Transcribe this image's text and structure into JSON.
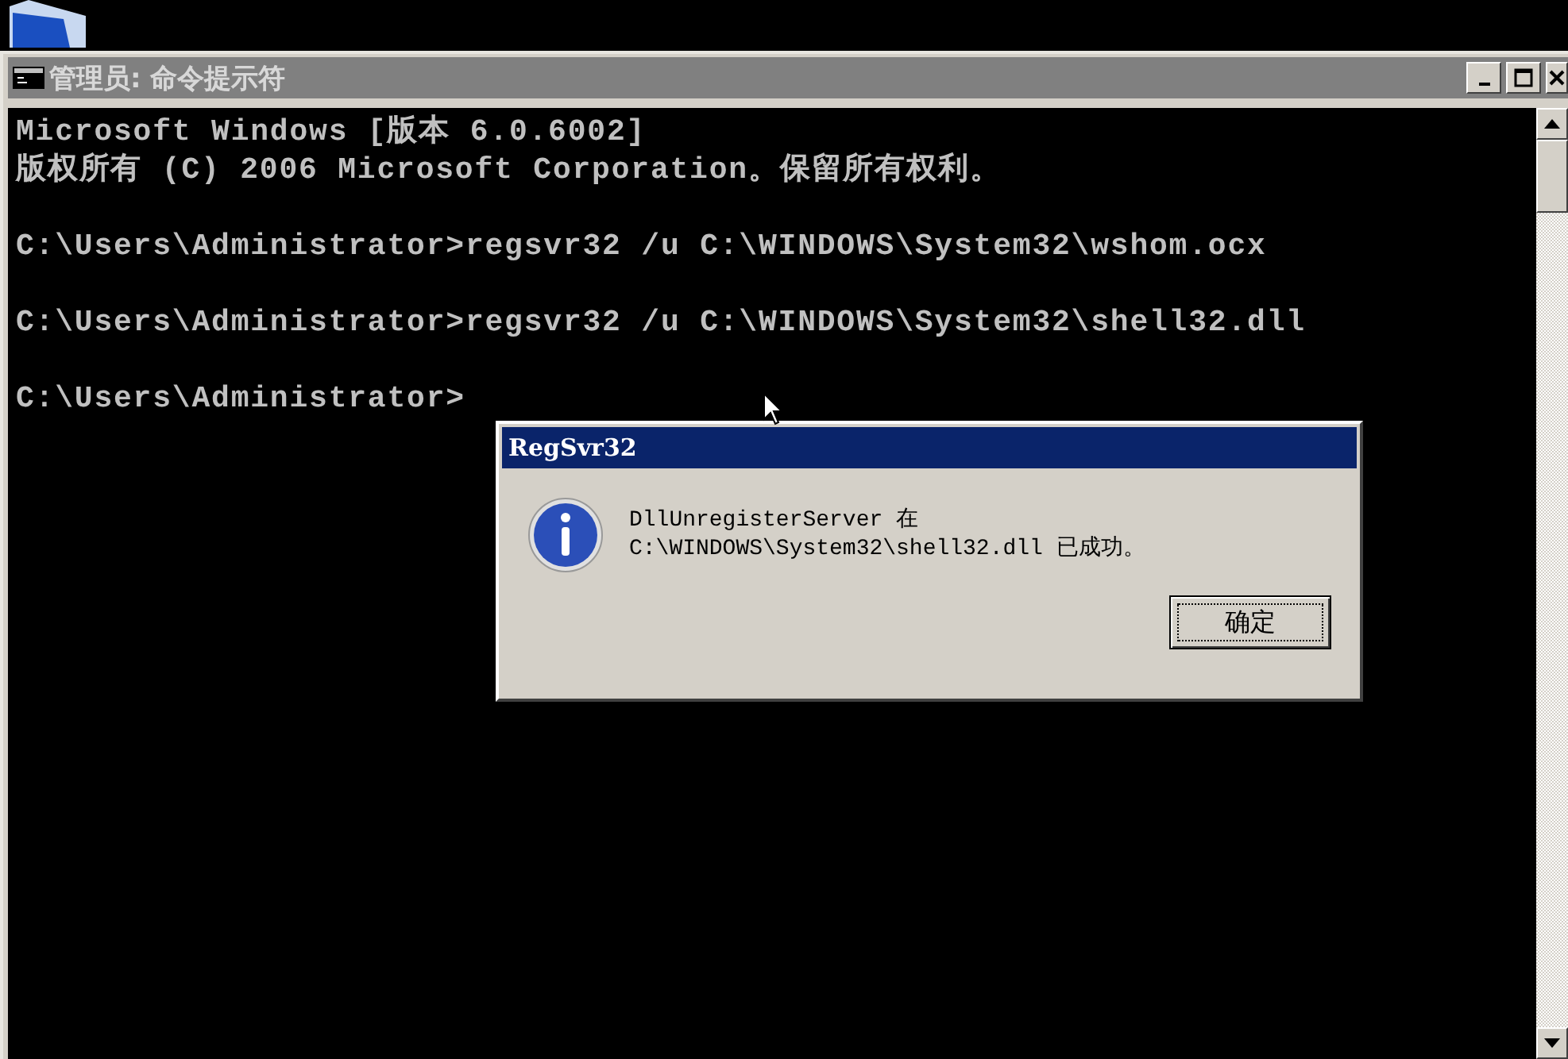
{
  "window": {
    "title": "管理员: 命令提示符"
  },
  "console": {
    "blocks": [
      [
        "Microsoft Windows [版本 6.0.6002]",
        "版权所有 (C) 2006 Microsoft Corporation。保留所有权利。"
      ],
      [
        "C:\\Users\\Administrator>regsvr32 /u C:\\WINDOWS\\System32\\wshom.ocx"
      ],
      [
        "C:\\Users\\Administrator>regsvr32 /u C:\\WINDOWS\\System32\\shell32.dll"
      ],
      [
        "C:\\Users\\Administrator>"
      ]
    ]
  },
  "dialog": {
    "title": "RegSvr32",
    "message_lines": [
      "DllUnregisterServer 在",
      "C:\\WINDOWS\\System32\\shell32.dll 已成功。"
    ],
    "button": "确定"
  }
}
